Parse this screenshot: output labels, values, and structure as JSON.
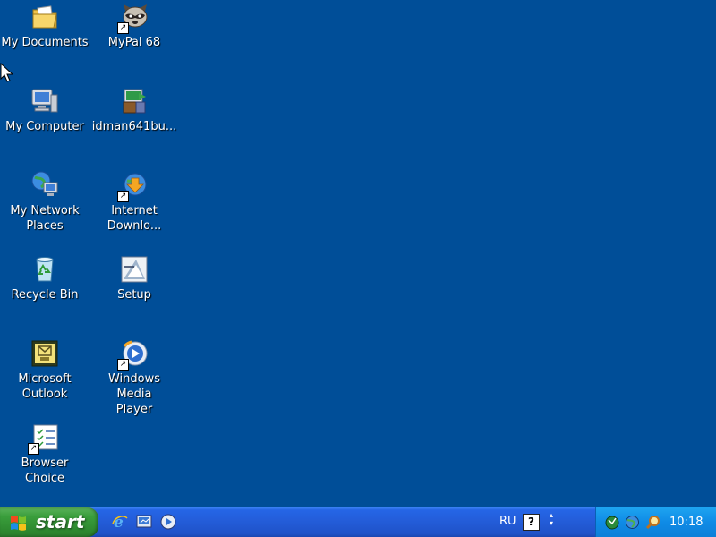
{
  "desktop": {
    "icons": [
      {
        "label": "My Documents",
        "icon": "folder-documents-icon"
      },
      {
        "label": "MyPal 68",
        "icon": "mypal-raccoon-icon",
        "shortcut": true
      },
      {
        "label": "My Computer",
        "icon": "computer-icon"
      },
      {
        "label": "idman641bu...",
        "icon": "installer-package-icon"
      },
      {
        "label": "My Network\nPlaces",
        "icon": "network-places-icon"
      },
      {
        "label": "Internet\nDownlo...",
        "icon": "internet-download-manager-icon",
        "shortcut": true
      },
      {
        "label": "Recycle Bin",
        "icon": "recycle-bin-icon"
      },
      {
        "label": "Setup",
        "icon": "setup-icon"
      },
      {
        "label": "Microsoft\nOutlook",
        "icon": "outlook-icon"
      },
      {
        "label": "Windows Media\nPlayer",
        "icon": "media-player-icon",
        "shortcut": true
      },
      {
        "label": "Browser Choice",
        "icon": "browser-choice-icon",
        "shortcut": true
      }
    ]
  },
  "taskbar": {
    "start_label": "start",
    "quick_launch": [
      "internet-explorer-icon",
      "show-desktop-icon",
      "media-player-icon"
    ],
    "language": "RU",
    "help_glyph": "?",
    "tray_icons": [
      "network-status-icon",
      "globe-icon",
      "search-icon"
    ],
    "clock": "10:18"
  },
  "colors": {
    "desktop_bg": "#004e98",
    "taskbar_blue": "#245edb",
    "start_green": "#3a9e3c",
    "tray_blue": "#0f8be6"
  }
}
